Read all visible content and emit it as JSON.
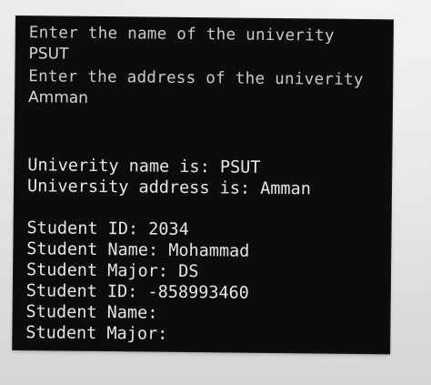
{
  "console": {
    "lines": [
      "Enter the name of the univerity",
      "PSUT",
      "Enter the address of the univerity",
      "Amman",
      "Univerity name is: PSUT",
      "University address is: Amman",
      "Student ID: 2034",
      "Student Name: Mohammad",
      "Student Major: DS",
      "Student ID: -858993460",
      "Student Name:",
      "Student Major:"
    ]
  }
}
